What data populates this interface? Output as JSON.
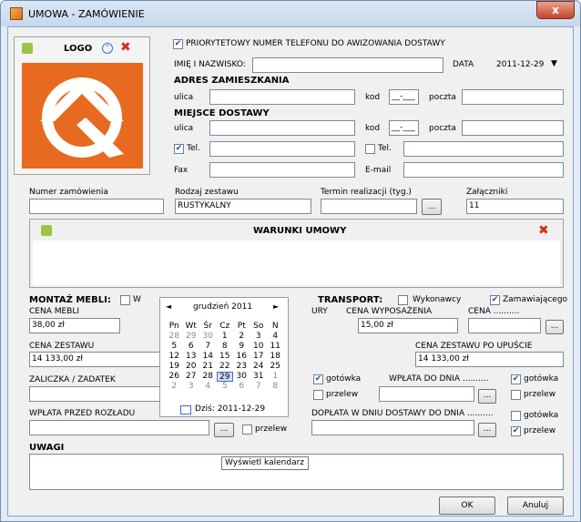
{
  "window": {
    "title": "UMOWA - ZAMÓWIENIE",
    "close": "x"
  },
  "logo": {
    "label": "LOGO"
  },
  "priority_phone": {
    "label": "PRIORYTETOWY NUMER TELEFONU DO AWIZOWANIA DOSTAWY"
  },
  "customer": {
    "name_label": "IMIĘ I NAZWISKO:",
    "date_label": "DATA",
    "date_value": "2011-12-29"
  },
  "address": {
    "title": "ADRES ZAMIESZKANIA",
    "street_label": "ulica",
    "zip_label": "kod",
    "zip_value": "__-___",
    "city_label": "poczta"
  },
  "delivery": {
    "title": "MIEJSCE DOSTAWY",
    "street_label": "ulica",
    "zip_label": "kod",
    "zip_value": "__-___",
    "city_label": "poczta"
  },
  "contacts": {
    "tel1_label": "Tel.",
    "tel2_label": "Tel.",
    "fax_label": "Fax",
    "email_label": "E-mail"
  },
  "order": {
    "number_label": "Numer zamówienia",
    "set_label": "Rodzaj zestawu",
    "set_value": "RUSTYKALNY",
    "term_label": "Termin realizacji (tyg.)",
    "attach_label": "Załączniki",
    "attach_value": "11",
    "dots": "..."
  },
  "terms": {
    "title": "WARUNKI UMOWY"
  },
  "assembly": {
    "title": "MONTAŻ MEBLI:",
    "opt": "W"
  },
  "transport": {
    "title": "TRANSPORT:",
    "opt1": "Wykonawcy",
    "opt2": "Zamawiającego"
  },
  "prices": {
    "furniture_label": "CENA MEBLI",
    "furniture_value": "38,00 zł",
    "ury_label": "URY",
    "equipment_label": "CENA WYPOSAŻENIA",
    "equipment_value": "15,00 zł",
    "cena_label": "CENA ..........",
    "set_label": "CENA ZESTAWU",
    "set_value": "14 133,00 zł",
    "discount_label": "CENA ZESTAWU PO UPUŚCIE",
    "discount_value": "14 133,00 zł",
    "deposit_label": "ZALICZKA / ZADATEK",
    "cash1": "gotówka",
    "transfer1": "przelew",
    "payment_label": "WPŁATA DO DNIA ..........",
    "cash2": "gotówka",
    "transfer2": "przelew",
    "before_label": "WPŁATA PRZED ROZŁADU",
    "transfer3": "przelew",
    "delivery_label": "DOPŁATA W DNIU DOSTAWY DO DNIA ..........",
    "cash4": "gotówka",
    "transfer4": "przelew",
    "hidden_cash": "gotówka"
  },
  "remarks": {
    "title": "UWAGI"
  },
  "buttons": {
    "ok": "OK",
    "cancel": "Anuluj"
  },
  "tooltip": "Wyświetl kalendarz",
  "calendar": {
    "prev": "◄",
    "next": "►",
    "month": "grudzień 2011",
    "weekdays": [
      "Pn",
      "Wt",
      "Śr",
      "Cz",
      "Pt",
      "So",
      "N"
    ],
    "weeks": [
      [
        "28",
        "29",
        "30",
        "1",
        "2",
        "3",
        "4"
      ],
      [
        "5",
        "6",
        "7",
        "8",
        "9",
        "10",
        "11"
      ],
      [
        "12",
        "13",
        "14",
        "15",
        "16",
        "17",
        "18"
      ],
      [
        "19",
        "20",
        "21",
        "22",
        "23",
        "24",
        "25"
      ],
      [
        "26",
        "27",
        "28",
        "29",
        "30",
        "31",
        "1"
      ],
      [
        "2",
        "3",
        "4",
        "5",
        "6",
        "7",
        "8"
      ]
    ],
    "today": "Dziś: 2011-12-29"
  }
}
